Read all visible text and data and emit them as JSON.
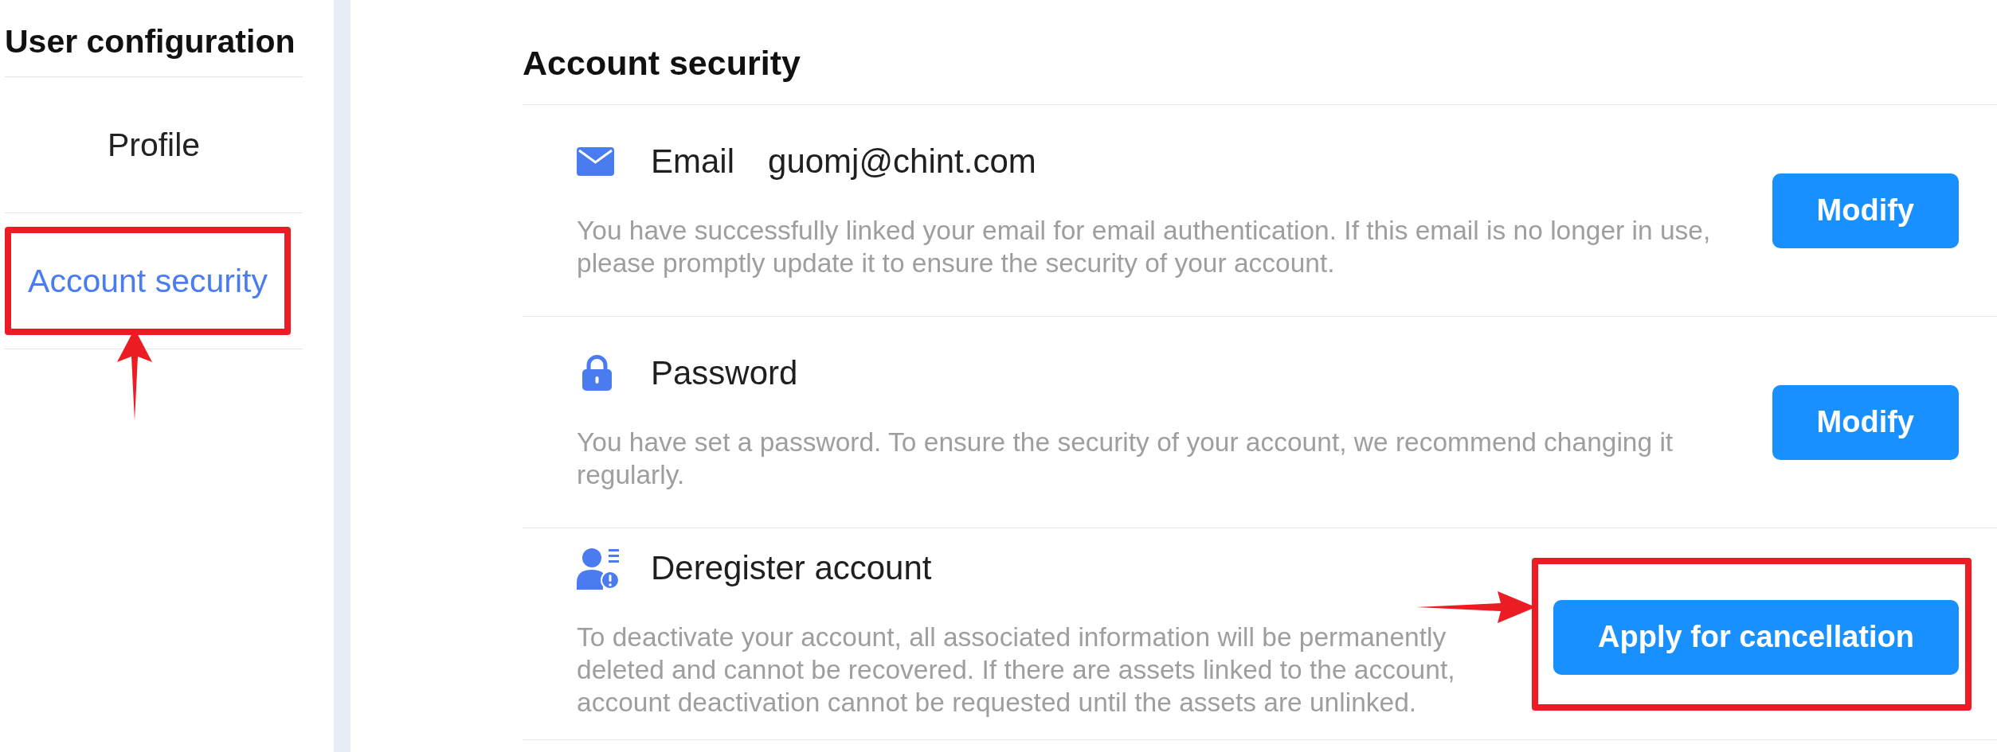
{
  "sidebar": {
    "title": "User configuration",
    "items": [
      {
        "label": "Profile",
        "selected": false,
        "highlighted": false
      },
      {
        "label": "Account security",
        "selected": true,
        "highlighted": true
      }
    ]
  },
  "main": {
    "title": "Account security",
    "rows": [
      {
        "kind": "email",
        "title": "Email",
        "value": "guomj@chint.com",
        "description": "You have successfully linked your email for email authentication. If this email is no longer in use, please promptly update it to ensure the security of your account.",
        "action": {
          "label": "Modify",
          "highlighted": false
        }
      },
      {
        "kind": "password",
        "title": "Password",
        "description": "You have set a password. To ensure the security of your account, we recommend changing it regularly.",
        "action": {
          "label": "Modify",
          "highlighted": false
        }
      },
      {
        "kind": "deregister",
        "title": "Deregister account",
        "description": "To deactivate your account, all associated information will be permanently deleted and cannot be recovered. If there are assets linked to the account, account deactivation cannot be requested until the assets are unlinked.",
        "action": {
          "label": "Apply for cancellation",
          "highlighted": true
        }
      }
    ]
  }
}
